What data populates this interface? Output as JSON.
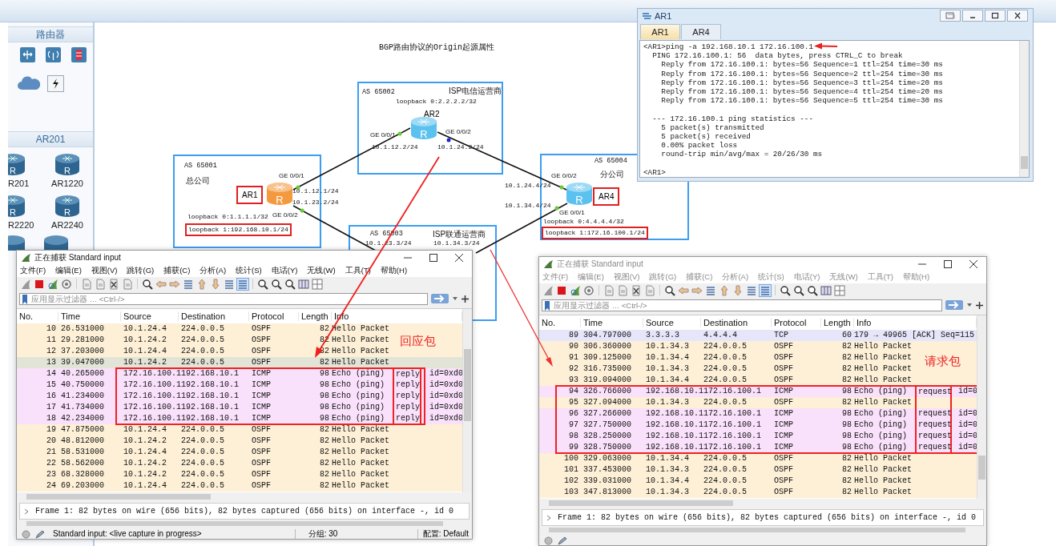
{
  "palette": {
    "sections": [
      {
        "title": "路由器"
      },
      {
        "title": "AR201",
        "models": [
          {
            "label": "R201",
            "badge": "R"
          },
          {
            "label": "AR1220",
            "badge": "R"
          },
          {
            "label": "R2220",
            "badge": "R"
          },
          {
            "label": "AR2240",
            "badge": "R"
          }
        ]
      }
    ]
  },
  "topology": {
    "title": "BGP路由协议的Origin起源属性",
    "areas": [
      {
        "as": "AS 65001",
        "name": "总公司"
      },
      {
        "as": "AS 65002",
        "name": "ISP电信运营商"
      },
      {
        "as": "AS 65003",
        "name": "ISP联通运营商"
      },
      {
        "as": "AS 65004",
        "name": "分公司"
      }
    ],
    "routers": [
      {
        "name": "AR1",
        "badge": "R",
        "color": "#f39a3f",
        "boxed": true
      },
      {
        "name": "AR2",
        "badge": "R",
        "color": "#5bc1ee",
        "boxed": false
      },
      {
        "name": "AR4",
        "badge": "R",
        "color": "#5bc1ee",
        "boxed": true
      }
    ],
    "labels": [
      {
        "text": "loopback 0:2.2.2.2/32",
        "boxed": false
      },
      {
        "text": "GE 0/0/1",
        "boxed": false
      },
      {
        "text": "GE 0/0/2",
        "boxed": false
      },
      {
        "text": "10.1.12.2/24",
        "boxed": false
      },
      {
        "text": "10.1.24.2/24",
        "boxed": false
      },
      {
        "text": "GE 0/0/1",
        "boxed": false
      },
      {
        "text": "10.1.12.1/24",
        "boxed": false
      },
      {
        "text": "10.1.23.2/24",
        "boxed": false
      },
      {
        "text": "GE 0/0/2",
        "boxed": false
      },
      {
        "text": "loopback 0:1.1.1.1/32",
        "boxed": false
      },
      {
        "text": "loopback 1:192.168.10.1/24",
        "boxed": true
      },
      {
        "text": "10.1.24.4/24",
        "boxed": false
      },
      {
        "text": "GE 0/0/2",
        "boxed": false
      },
      {
        "text": "10.1.34.4/24",
        "boxed": false
      },
      {
        "text": "GE 0/0/1",
        "boxed": false
      },
      {
        "text": "loopback 0:4.4.4.4/32",
        "boxed": false
      },
      {
        "text": "loopback 1:172.16.100.1/24",
        "boxed": true
      },
      {
        "text": "10.1.23.3/24",
        "boxed": false
      },
      {
        "text": "10.1.34.3/24",
        "boxed": false
      }
    ]
  },
  "console": {
    "title": "AR1",
    "tabs": [
      {
        "label": "AR1",
        "selected": true
      },
      {
        "label": "AR4",
        "selected": false
      }
    ],
    "blocks": [
      [
        "<AR1>ping -a 192.168.10.1 172.16.100.1",
        "  PING 172.16.100.1: 56  data bytes, press CTRL_C to break",
        "    Reply from 172.16.100.1: bytes=56 Sequence=1 ttl=254 time=30 ms",
        "    Reply from 172.16.100.1: bytes=56 Sequence=2 ttl=254 time=30 ms",
        "    Reply from 172.16.100.1: bytes=56 Sequence=3 ttl=254 time=20 ms",
        "    Reply from 172.16.100.1: bytes=56 Sequence=4 ttl=254 time=20 ms",
        "    Reply from 172.16.100.1: bytes=56 Sequence=5 ttl=254 time=30 ms"
      ],
      [
        "  --- 172.16.100.1 ping statistics ---",
        "    5 packet(s) transmitted",
        "    5 packet(s) received",
        "    0.00% packet loss",
        "    round-trip min/avg/max = 20/26/30 ms"
      ],
      [
        "<AR1>"
      ]
    ]
  },
  "captures": [
    {
      "title": "正在捕获 Standard input",
      "active": true,
      "menu": [
        "文件(F)",
        "编辑(E)",
        "视图(V)",
        "跳转(G)",
        "捕获(C)",
        "分析(A)",
        "统计(S)",
        "电话(Y)",
        "无线(W)",
        "工具(T)",
        "帮助(H)"
      ],
      "filter_placeholder": "应用显示过滤器 … <Ctrl-/>",
      "columns": [
        "No.",
        "Time",
        "Source",
        "Destination",
        "Protocol",
        "Length",
        "Info"
      ],
      "annotation": "回应包",
      "rows": [
        {
          "no": "10",
          "time": "26.531000",
          "source": "10.1.24.4",
          "destination": "224.0.0.5",
          "protocol": "OSPF",
          "length": "82",
          "info": "Hello Packet",
          "kind": "ospf",
          "selected": false,
          "highlighted": false
        },
        {
          "no": "11",
          "time": "29.281000",
          "source": "10.1.24.2",
          "destination": "224.0.0.5",
          "protocol": "OSPF",
          "length": "82",
          "info": "Hello Packet",
          "kind": "ospf",
          "selected": false,
          "highlighted": false
        },
        {
          "no": "12",
          "time": "37.203000",
          "source": "10.1.24.4",
          "destination": "224.0.0.5",
          "protocol": "OSPF",
          "length": "82",
          "info": "Hello Packet",
          "kind": "ospf",
          "selected": false,
          "highlighted": false
        },
        {
          "no": "13",
          "time": "39.047000",
          "source": "10.1.24.2",
          "destination": "224.0.0.5",
          "protocol": "OSPF",
          "length": "82",
          "info": "Hello Packet",
          "kind": "ospf",
          "selected": true,
          "highlighted": false
        },
        {
          "no": "14",
          "time": "40.265000",
          "source": "172.16.100.1",
          "destination": "192.168.10.1",
          "protocol": "ICMP",
          "length": "98",
          "info": "Echo (ping)",
          "flag": "reply",
          "id": "id=0xd0",
          "kind": "icmp",
          "selected": false,
          "highlighted": true
        },
        {
          "no": "15",
          "time": "40.750000",
          "source": "172.16.100.1",
          "destination": "192.168.10.1",
          "protocol": "ICMP",
          "length": "98",
          "info": "Echo (ping)",
          "flag": "reply",
          "id": "id=0xd0",
          "kind": "icmp",
          "selected": false,
          "highlighted": true
        },
        {
          "no": "16",
          "time": "41.234000",
          "source": "172.16.100.1",
          "destination": "192.168.10.1",
          "protocol": "ICMP",
          "length": "98",
          "info": "Echo (ping)",
          "flag": "reply",
          "id": "id=0xd0",
          "kind": "icmp",
          "selected": false,
          "highlighted": true
        },
        {
          "no": "17",
          "time": "41.734000",
          "source": "172.16.100.1",
          "destination": "192.168.10.1",
          "protocol": "ICMP",
          "length": "98",
          "info": "Echo (ping)",
          "flag": "reply",
          "id": "id=0xd0",
          "kind": "icmp",
          "selected": false,
          "highlighted": true
        },
        {
          "no": "18",
          "time": "42.234000",
          "source": "172.16.100.1",
          "destination": "192.168.10.1",
          "protocol": "ICMP",
          "length": "98",
          "info": "Echo (ping)",
          "flag": "reply",
          "id": "id=0xd0",
          "kind": "icmp",
          "selected": false,
          "highlighted": true
        },
        {
          "no": "19",
          "time": "47.875000",
          "source": "10.1.24.4",
          "destination": "224.0.0.5",
          "protocol": "OSPF",
          "length": "82",
          "info": "Hello Packet",
          "kind": "ospf",
          "selected": false,
          "highlighted": false
        },
        {
          "no": "20",
          "time": "48.812000",
          "source": "10.1.24.2",
          "destination": "224.0.0.5",
          "protocol": "OSPF",
          "length": "82",
          "info": "Hello Packet",
          "kind": "ospf",
          "selected": false,
          "highlighted": false
        },
        {
          "no": "21",
          "time": "58.531000",
          "source": "10.1.24.4",
          "destination": "224.0.0.5",
          "protocol": "OSPF",
          "length": "82",
          "info": "Hello Packet",
          "kind": "ospf",
          "selected": false,
          "highlighted": false
        },
        {
          "no": "22",
          "time": "58.562000",
          "source": "10.1.24.2",
          "destination": "224.0.0.5",
          "protocol": "OSPF",
          "length": "82",
          "info": "Hello Packet",
          "kind": "ospf",
          "selected": false,
          "highlighted": false
        },
        {
          "no": "23",
          "time": "68.328000",
          "source": "10.1.24.2",
          "destination": "224.0.0.5",
          "protocol": "OSPF",
          "length": "82",
          "info": "Hello Packet",
          "kind": "ospf",
          "selected": false,
          "highlighted": false
        },
        {
          "no": "24",
          "time": "69.203000",
          "source": "10.1.24.4",
          "destination": "224.0.0.5",
          "protocol": "OSPF",
          "length": "82",
          "info": "Hello Packet",
          "kind": "ospf",
          "selected": false,
          "highlighted": false
        }
      ],
      "detail": "Frame 1: 82 bytes on wire (656 bits), 82 bytes captured (656 bits) on interface -, id 0",
      "status": {
        "text": "Standard input: <live capture in progress>",
        "packets": "分组: 30",
        "profile": "配置: Default"
      }
    },
    {
      "title": "正在捕获 Standard input",
      "active": false,
      "menu": [
        "文件(F)",
        "编辑(E)",
        "视图(V)",
        "跳转(G)",
        "捕获(C)",
        "分析(A)",
        "统计(S)",
        "电话(Y)",
        "无线(W)",
        "工具(T)",
        "帮助(H)"
      ],
      "filter_placeholder": "应用显示过滤器 … <Ctrl-/>",
      "columns": [
        "No.",
        "Time",
        "Source",
        "Destination",
        "Protocol",
        "Length",
        "Info"
      ],
      "annotation": "请求包",
      "rows": [
        {
          "no": "89",
          "time": "304.797000",
          "source": "3.3.3.3",
          "destination": "4.4.4.4",
          "protocol": "TCP",
          "length": "60",
          "info": "179 → 49965 [ACK] Seq=115",
          "kind": "tcp",
          "selected": false,
          "highlighted": false
        },
        {
          "no": "90",
          "time": "306.360000",
          "source": "10.1.34.3",
          "destination": "224.0.0.5",
          "protocol": "OSPF",
          "length": "82",
          "info": "Hello Packet",
          "kind": "ospf",
          "selected": false,
          "highlighted": false
        },
        {
          "no": "91",
          "time": "309.125000",
          "source": "10.1.34.4",
          "destination": "224.0.0.5",
          "protocol": "OSPF",
          "length": "82",
          "info": "Hello Packet",
          "kind": "ospf",
          "selected": false,
          "highlighted": false
        },
        {
          "no": "92",
          "time": "316.735000",
          "source": "10.1.34.3",
          "destination": "224.0.0.5",
          "protocol": "OSPF",
          "length": "82",
          "info": "Hello Packet",
          "kind": "ospf",
          "selected": false,
          "highlighted": false
        },
        {
          "no": "93",
          "time": "319.094000",
          "source": "10.1.34.4",
          "destination": "224.0.0.5",
          "protocol": "OSPF",
          "length": "82",
          "info": "Hello Packet",
          "kind": "ospf",
          "selected": false,
          "highlighted": false
        },
        {
          "no": "94",
          "time": "326.766000",
          "source": "192.168.10.1",
          "destination": "172.16.100.1",
          "protocol": "ICMP",
          "length": "98",
          "info": "Echo (ping)",
          "flag": "request",
          "id": "id=0",
          "kind": "icmp",
          "selected": false,
          "highlighted": true
        },
        {
          "no": "95",
          "time": "327.094000",
          "source": "10.1.34.3",
          "destination": "224.0.0.5",
          "protocol": "OSPF",
          "length": "82",
          "info": "Hello Packet",
          "kind": "ospf",
          "selected": false,
          "highlighted": true
        },
        {
          "no": "96",
          "time": "327.266000",
          "source": "192.168.10.1",
          "destination": "172.16.100.1",
          "protocol": "ICMP",
          "length": "98",
          "info": "Echo (ping)",
          "flag": "request",
          "id": "id=0",
          "kind": "icmp",
          "selected": false,
          "highlighted": true
        },
        {
          "no": "97",
          "time": "327.750000",
          "source": "192.168.10.1",
          "destination": "172.16.100.1",
          "protocol": "ICMP",
          "length": "98",
          "info": "Echo (ping)",
          "flag": "request",
          "id": "id=0",
          "kind": "icmp",
          "selected": false,
          "highlighted": true
        },
        {
          "no": "98",
          "time": "328.250000",
          "source": "192.168.10.1",
          "destination": "172.16.100.1",
          "protocol": "ICMP",
          "length": "98",
          "info": "Echo (ping)",
          "flag": "request",
          "id": "id=0",
          "kind": "icmp",
          "selected": false,
          "highlighted": true
        },
        {
          "no": "99",
          "time": "328.750000",
          "source": "192.168.10.1",
          "destination": "172.16.100.1",
          "protocol": "ICMP",
          "length": "98",
          "info": "Echo (ping)",
          "flag": "request",
          "id": "id=0",
          "kind": "icmp",
          "selected": false,
          "highlighted": true
        },
        {
          "no": "100",
          "time": "329.063000",
          "source": "10.1.34.4",
          "destination": "224.0.0.5",
          "protocol": "OSPF",
          "length": "82",
          "info": "Hello Packet",
          "kind": "ospf",
          "selected": false,
          "highlighted": false
        },
        {
          "no": "101",
          "time": "337.453000",
          "source": "10.1.34.3",
          "destination": "224.0.0.5",
          "protocol": "OSPF",
          "length": "82",
          "info": "Hello Packet",
          "kind": "ospf",
          "selected": false,
          "highlighted": false
        },
        {
          "no": "102",
          "time": "339.031000",
          "source": "10.1.34.4",
          "destination": "224.0.0.5",
          "protocol": "OSPF",
          "length": "82",
          "info": "Hello Packet",
          "kind": "ospf",
          "selected": false,
          "highlighted": false
        },
        {
          "no": "103",
          "time": "347.813000",
          "source": "10.1.34.3",
          "destination": "224.0.0.5",
          "protocol": "OSPF",
          "length": "82",
          "info": "Hello Packet",
          "kind": "ospf",
          "selected": false,
          "highlighted": false
        }
      ],
      "detail": "Frame 1: 82 bytes on wire (656 bits), 82 bytes captured (656 bits) on interface -, id 0"
    }
  ]
}
